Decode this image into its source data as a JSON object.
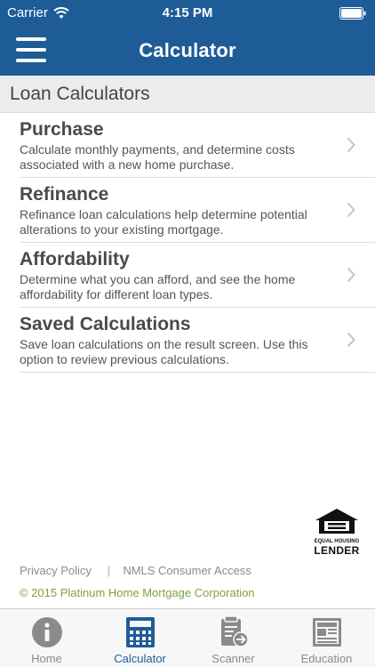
{
  "status_bar": {
    "carrier": "Carrier",
    "time": "4:15 PM",
    "wifi_icon": "wifi-icon",
    "battery_icon": "battery-icon"
  },
  "navbar": {
    "title": "Calculator",
    "menu_icon": "hamburger-menu-icon",
    "background": "#1e5c97"
  },
  "section": {
    "title": "Loan Calculators"
  },
  "calculators": [
    {
      "title": "Purchase",
      "description": "Calculate monthly payments, and determine costs associated with a new home purchase."
    },
    {
      "title": "Refinance",
      "description": "Refinance loan calculations help determine potential alterations to your existing mortgage."
    },
    {
      "title": "Affordability",
      "description": "Determine what you can afford, and see the home affordability for different loan types."
    },
    {
      "title": "Saved Calculations",
      "description": "Save loan calculations on the result screen. Use this option to review previous calculations."
    }
  ],
  "logo": {
    "line1": "EQUAL HOUSING",
    "line2": "LENDER",
    "icon": "equal-housing-icon"
  },
  "footer": {
    "privacy_link": "Privacy Policy",
    "separator": "|",
    "nmls_link": "NMLS Consumer Access",
    "copyright": "© 2015 Platinum Home Mortgage Corporation",
    "copyright_color": "#7ea33c"
  },
  "tabs": [
    {
      "label": "Home",
      "icon": "info-icon",
      "active": false
    },
    {
      "label": "Calculator",
      "icon": "calculator-icon",
      "active": true
    },
    {
      "label": "Scanner",
      "icon": "scanner-icon",
      "active": false
    },
    {
      "label": "Education",
      "icon": "newspaper-icon",
      "active": false
    }
  ],
  "colors": {
    "accent": "#1e5c97",
    "inactive_tab": "#8a8a8a"
  }
}
